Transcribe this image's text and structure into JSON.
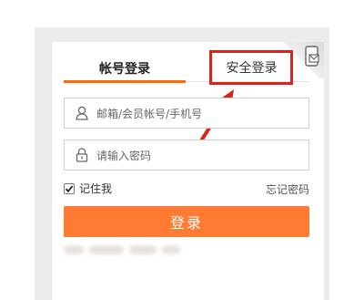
{
  "tabs": {
    "account_login": "帐号登录",
    "secure_login": "安全登录"
  },
  "fields": {
    "username_placeholder": "邮箱/会员帐号/手机号",
    "password_placeholder": "请输入密码"
  },
  "remember_me": {
    "label": "记住我",
    "checked": true
  },
  "forgot_password": "忘记密码",
  "login_button": "登录",
  "colors": {
    "accent": "#ff6a00",
    "button": "#ff7a32",
    "highlight": "#d9241b"
  },
  "icons": {
    "user": "user-icon",
    "lock": "lock-icon",
    "qr_toggle": "qrcode-toggle-icon",
    "check": "checkmark-icon"
  }
}
